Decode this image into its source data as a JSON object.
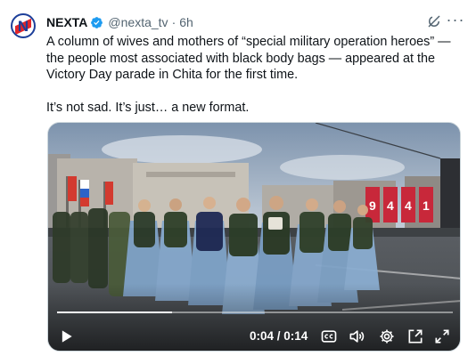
{
  "post": {
    "author_name": "NEXTA",
    "handle": "@nexta_tv",
    "separator": "·",
    "time": "6h",
    "more_label": "···",
    "text_lines": [
      "A column of wives and mothers of “special military operation heroes” —",
      "the people most associated with black body bags — appeared at the",
      "Victory Day parade in Chita for the first time."
    ],
    "text_2": "It’s not sad. It’s just… a new format."
  },
  "video": {
    "timecode": "0:04 / 0:14",
    "progress": 0.29,
    "poster_numerals": [
      "9",
      "4",
      "4",
      "1"
    ]
  },
  "colors": {
    "verified": "#1d9bf0",
    "text_primary": "#0f1419",
    "text_secondary": "#536471",
    "avatar_blue": "#1d3f9a",
    "avatar_red": "#e0262b"
  },
  "icons": [
    "verified-badge-icon",
    "grok-icon",
    "more-icon",
    "play-icon",
    "captions-icon",
    "volume-icon",
    "settings-gear-icon",
    "picture-in-picture-icon",
    "fullscreen-icon"
  ]
}
